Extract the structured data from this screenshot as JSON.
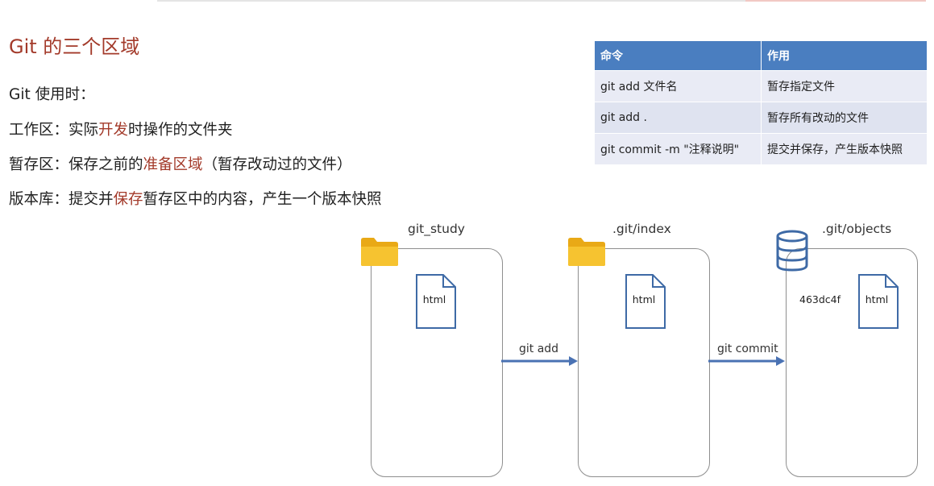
{
  "title": "Git 的三个区域",
  "lines": {
    "intro": "Git 使用时：",
    "workspace_pre": "工作区：实际",
    "workspace_hl": "开发",
    "workspace_post": "时操作的文件夹",
    "staging_pre": "暂存区：保存之前的",
    "staging_hl": "准备区域",
    "staging_post": "（暂存改动过的文件）",
    "repo_pre": "版本库：提交并",
    "repo_hl": "保存",
    "repo_post": "暂存区中的内容，产生一个版本快照"
  },
  "table": {
    "headers": [
      "命令",
      "作用"
    ],
    "rows": [
      [
        "git add 文件名",
        "暂存指定文件"
      ],
      [
        "git add .",
        "暂存所有改动的文件"
      ],
      [
        "git commit -m \"注释说明\"",
        "提交并保存，产生版本快照"
      ]
    ]
  },
  "diagram": {
    "panels": [
      {
        "label": "git_study",
        "icon": "folder-icon",
        "file": "html"
      },
      {
        "label": ".git/index",
        "icon": "folder-icon",
        "file": "html"
      },
      {
        "label": ".git/objects",
        "icon": "database-icon",
        "file": "html",
        "hash": "463dc4f"
      }
    ],
    "arrows": [
      {
        "label": "git add"
      },
      {
        "label": "git commit"
      }
    ]
  },
  "colors": {
    "accent": "#a33a2a",
    "table_header": "#4a7ec0",
    "table_row": "#e9ebf5",
    "arrow": "#4a72b3",
    "folder": "#f6c330"
  }
}
